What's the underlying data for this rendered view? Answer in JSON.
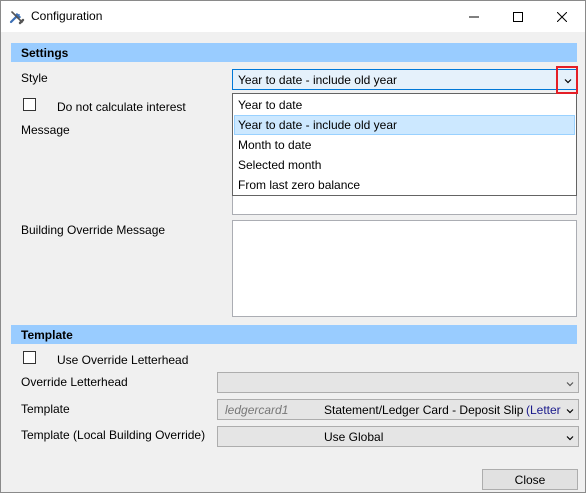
{
  "window": {
    "title": "Configuration"
  },
  "settings": {
    "header": "Settings",
    "style_label": "Style",
    "style_value": "Year to date - include old year",
    "style_options": [
      "Year to date",
      "Year to date - include old year",
      "Month to date",
      "Selected month",
      "From last zero balance"
    ],
    "selected_option_index": 1,
    "no_interest_label": "Do not calculate interest",
    "no_interest_checked": false,
    "message_label": "Message",
    "message_value": "",
    "building_override_label": "Building Override Message",
    "building_override_value": ""
  },
  "template": {
    "header": "Template",
    "use_override_label": "Use Override Letterhead",
    "use_override_checked": false,
    "override_letterhead_label": "Override Letterhead",
    "override_letterhead_value": "",
    "template_label": "Template",
    "template_code": "ledgercard1",
    "template_name": "Statement/Ledger Card - Deposit Slip",
    "template_suffix": "(Letter",
    "local_override_label": "Template (Local Building Override)",
    "local_override_value": "Use Global"
  },
  "footer": {
    "close_label": "Close"
  },
  "colors": {
    "section_header": "#99ccff",
    "selection_bg": "#cce8ff",
    "highlight_border": "#e41e26",
    "suffix_text": "#1a1a8c"
  },
  "icons": {
    "title": "tools-icon",
    "minimize": "minimize-icon",
    "maximize": "maximize-icon",
    "close": "close-icon",
    "combo_arrow": "chevron-down-icon"
  }
}
